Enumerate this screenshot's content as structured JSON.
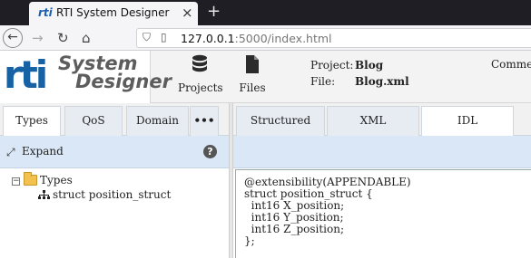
{
  "browser": {
    "tab_title": "RTI System Designer",
    "favicon_text": "rti",
    "close_glyph": "×",
    "new_tab_glyph": "+",
    "url_host": "127.0.0.1",
    "url_rest": ":5000/index.html"
  },
  "header": {
    "logo_mark": "rti",
    "logo_line1": "System",
    "logo_line2": "Designer",
    "projects_label": "Projects",
    "files_label": "Files",
    "project_key": "Project:",
    "project_value": "Blog",
    "file_key": "File:",
    "file_value": "Blog.xml",
    "comments_label": "Comments"
  },
  "left_panel": {
    "tabs": [
      "Types",
      "QoS",
      "Domain",
      "•••"
    ],
    "active_tab": "Types",
    "expand_label": "Expand",
    "help_glyph": "?",
    "tree": {
      "root_label": "Types",
      "toggle_glyph": "−",
      "child_label": "struct position_struct"
    }
  },
  "right_panel": {
    "tabs": [
      "Structured",
      "XML",
      "IDL"
    ],
    "active_tab": "IDL",
    "code_lines": [
      "@extensibility(APPENDABLE)",
      "struct position_struct {",
      "  int16 X_position;",
      "  int16 Y_position;",
      "  int16 Z_position;",
      "};"
    ]
  },
  "icons": {
    "back": "arrow-left-icon",
    "forward": "arrow-right-icon",
    "reload": "reload-icon",
    "home": "home-icon",
    "projects": "database-icon",
    "files": "file-icon",
    "expand": "expand-arrows-icon",
    "help": "question-circle-icon",
    "folder": "folder-icon",
    "struct": "hierarchy-icon"
  },
  "colors": {
    "brand_blue": "#1761a5",
    "panel_bar": "#d9e7f6",
    "tab_inactive": "#e7ebf2",
    "browser_dark": "#1f1e24"
  }
}
